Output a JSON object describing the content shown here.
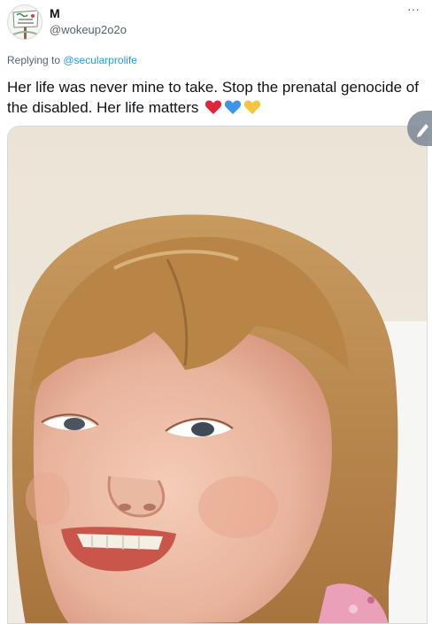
{
  "author": {
    "display_name": "M",
    "handle": "@wokeup2o2o",
    "avatar_icon": "protest-sign-avatar-icon"
  },
  "menu": {
    "more_label": "···",
    "icon": "more-options-icon"
  },
  "reply": {
    "prefix": "Replying to ",
    "to_handle": "@secularprolife"
  },
  "tweet": {
    "text": "Her life was never mine to take. Stop the prenatal genocide of the disabled. Her life matters",
    "emojis": [
      "red-heart-icon",
      "blue-heart-icon",
      "yellow-heart-icon"
    ]
  },
  "media": {
    "type": "photo",
    "subject_icon": "smiling-child-photo",
    "edit_icon": "edit-pencil-icon"
  },
  "colors": {
    "link": "#1d9bf0",
    "secondary_text": "#536471",
    "primary_text": "#0f1419",
    "red_heart": "#e0243a",
    "blue_heart": "#3d96e6",
    "yellow_heart": "#f5c542"
  }
}
